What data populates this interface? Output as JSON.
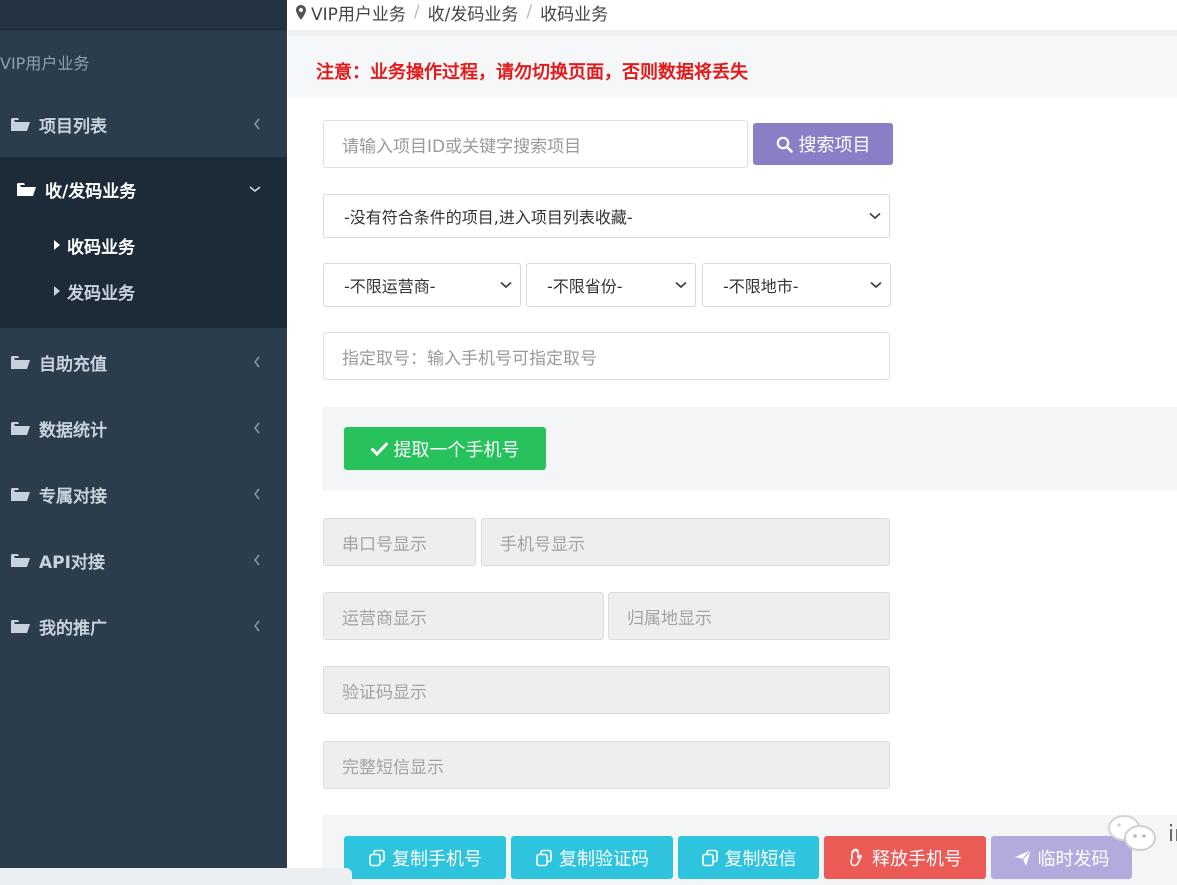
{
  "sidebar": {
    "header": "VIP用户业务",
    "items": [
      {
        "label": "项目列表"
      },
      {
        "label": "收/发码业务"
      },
      {
        "label": "自助充值"
      },
      {
        "label": "数据统计"
      },
      {
        "label": "专属对接"
      },
      {
        "label": "API对接"
      },
      {
        "label": "我的推广"
      }
    ],
    "subitems": [
      {
        "label": "收码业务"
      },
      {
        "label": "发码业务"
      }
    ]
  },
  "breadcrumb": [
    "VIP用户业务",
    "收/发码业务",
    "收码业务"
  ],
  "notice": "注意：业务操作过程，请勿切换页面，否则数据将丢失",
  "search": {
    "placeholder": "请输入项目ID或关键字搜索项目",
    "button": "搜索项目"
  },
  "project_select": "-没有符合条件的项目,进入项目列表收藏-",
  "filters": {
    "carrier": "-不限运营商-",
    "province": "-不限省份-",
    "city": "-不限地市-"
  },
  "designate": {
    "placeholder": "指定取号：输入手机号可指定取号"
  },
  "take_button": "提取一个手机号",
  "displays": {
    "port": "串口号显示",
    "phone": "手机号显示",
    "carrier": "运营商显示",
    "location": "归属地显示",
    "code": "验证码显示",
    "sms": "完整短信显示"
  },
  "actions": {
    "copy_phone": "复制手机号",
    "copy_code": "复制验证码",
    "copy_sms": "复制短信",
    "release": "释放手机号",
    "temp_send": "临时发码"
  },
  "colors": {
    "sidebar": "#2b3c4d",
    "notice": "#e21c1c",
    "search_btn": "#8a7fc6",
    "take_btn": "#27c25c",
    "copy_btn": "#2ec4dd",
    "release_btn": "#ec5a56",
    "temp_btn": "#b3abde"
  },
  "watermark_text": "iri"
}
